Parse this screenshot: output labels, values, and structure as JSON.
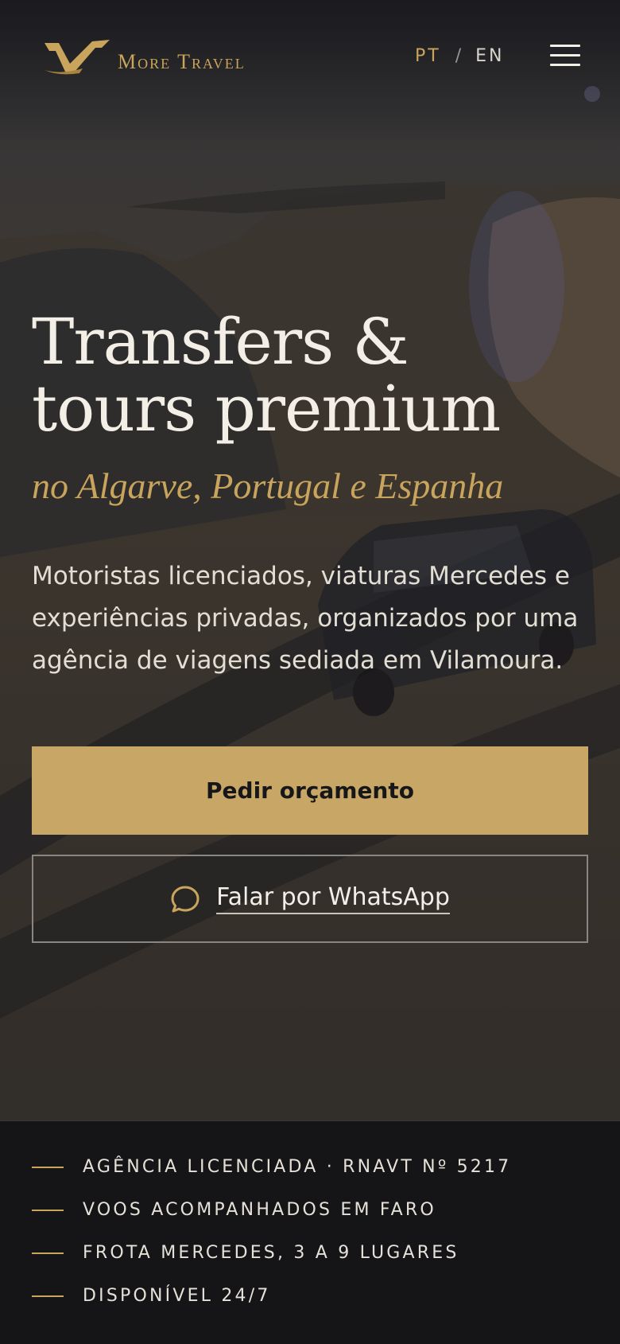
{
  "header": {
    "brand_name": "More Travel",
    "language": {
      "pt": "PT",
      "separator": "/",
      "en": "EN",
      "active": "PT"
    },
    "menu_icon": "hamburger-menu-icon"
  },
  "hero": {
    "title_line1": "Transfers &",
    "title_line2": "tours premium",
    "subtitle": "no Algarve, Portugal e Espanha",
    "description": "Motoristas licenciados, viaturas Mercedes e experiências privadas, organizados por uma agência de viagens sediada em Vilamoura.",
    "primary_cta": "Pedir orçamento",
    "secondary_cta": "Falar por WhatsApp",
    "secondary_icon": "chat-bubble-icon"
  },
  "features": [
    "AGÊNCIA LICENCIADA · RNAVT Nº 5217",
    "VOOS ACOMPANHADOS EM FARO",
    "FROTA MERCEDES, 3 A 9 LUGARES",
    "DISPONÍVEL 24/7"
  ],
  "colors": {
    "accent_gold": "#c8a766",
    "background_dark": "#17171a",
    "text_light": "#f3efe6"
  }
}
